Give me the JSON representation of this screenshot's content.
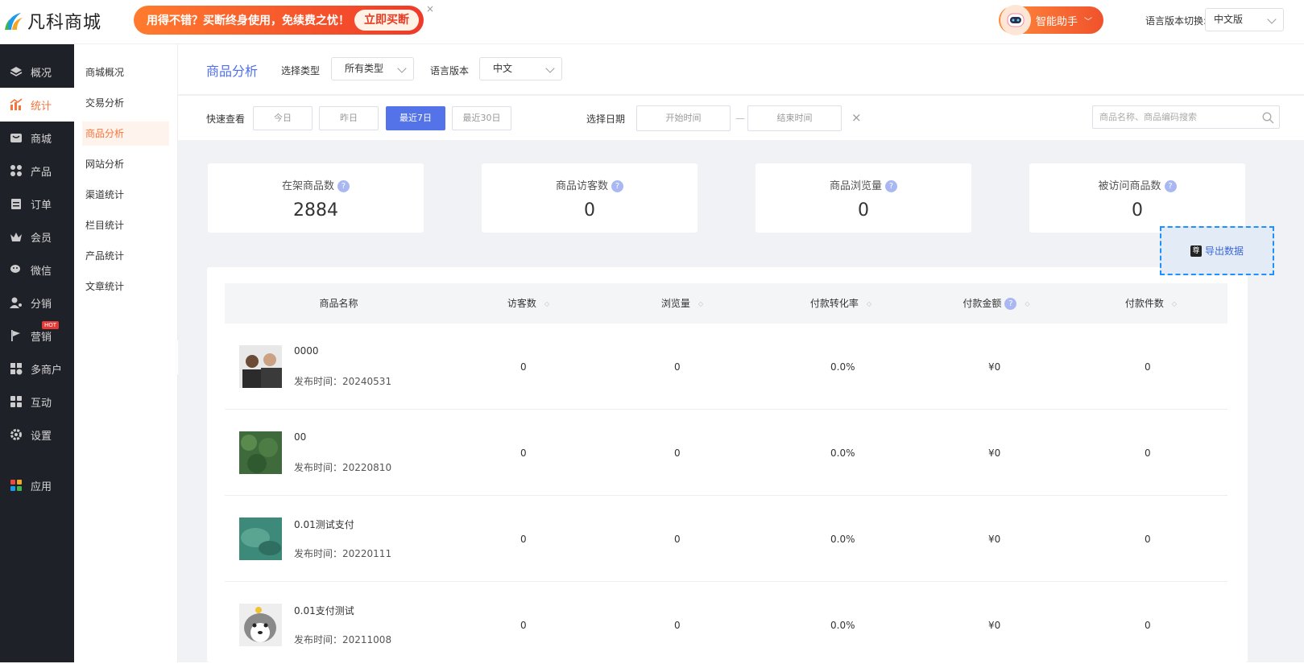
{
  "topbar": {
    "logo_text": "凡科商城",
    "banner_text": "用得不错？买断终身使用，免续费之忧！",
    "banner_button": "立即买断",
    "banner_close": "×",
    "assistant_label": "智能助手",
    "lang_switch_label": "语言版本切换:",
    "lang_value": "中文版"
  },
  "sidebar": {
    "items": [
      {
        "label": "概况",
        "icon": "layers-icon"
      },
      {
        "label": "统计",
        "icon": "chart-icon"
      },
      {
        "label": "商城",
        "icon": "shop-icon"
      },
      {
        "label": "产品",
        "icon": "product-icon"
      },
      {
        "label": "订单",
        "icon": "order-icon"
      },
      {
        "label": "会员",
        "icon": "crown-icon"
      },
      {
        "label": "微信",
        "icon": "wechat-icon"
      },
      {
        "label": "分销",
        "icon": "distribution-icon"
      },
      {
        "label": "营销",
        "icon": "flag-icon",
        "badge": "HOT"
      },
      {
        "label": "多商户",
        "icon": "merchant-icon"
      },
      {
        "label": "互动",
        "icon": "interact-icon"
      },
      {
        "label": "设置",
        "icon": "gear-icon"
      },
      {
        "label": "应用",
        "icon": "apps-icon"
      }
    ]
  },
  "subnav": {
    "items": [
      "商城概况",
      "交易分析",
      "商品分析",
      "网站分析",
      "渠道统计",
      "栏目统计",
      "产品统计",
      "文章统计"
    ]
  },
  "filters": {
    "title": "商品分析",
    "type_label": "选择类型",
    "type_value": "所有类型",
    "lang_label": "语言版本",
    "lang_value": "中文",
    "quick_label": "快速查看",
    "quick": [
      "今日",
      "昨日",
      "最近7日",
      "最近30日"
    ],
    "date_label": "选择日期",
    "start_placeholder": "开始时间",
    "date_sep": "—",
    "end_placeholder": "结束时间",
    "clear": "×",
    "search_placeholder": "商品名称、商品编码搜索"
  },
  "cards": [
    {
      "label": "在架商品数",
      "value": "2884"
    },
    {
      "label": "商品访客数",
      "value": "0"
    },
    {
      "label": "商品浏览量",
      "value": "0"
    },
    {
      "label": "被访问商品数",
      "value": "0"
    }
  ],
  "export_label": "导出数据",
  "export_icon_text": "尊",
  "table": {
    "headers": [
      "商品名称",
      "访客数",
      "浏览量",
      "付款转化率",
      "付款金额",
      "付款件数"
    ],
    "rows": [
      {
        "name": "0000",
        "date": "发布时间：20240531",
        "visitors": "0",
        "views": "0",
        "rate": "0.0%",
        "amount": "¥0",
        "count": "0",
        "thumb": "people"
      },
      {
        "name": "00",
        "date": "发布时间：20220810",
        "visitors": "0",
        "views": "0",
        "rate": "0.0%",
        "amount": "¥0",
        "count": "0",
        "thumb": "forest"
      },
      {
        "name": "0.01测试支付",
        "date": "发布时间：20220111",
        "visitors": "0",
        "views": "0",
        "rate": "0.0%",
        "amount": "¥0",
        "count": "0",
        "thumb": "water"
      },
      {
        "name": "0.01支付测试",
        "date": "发布时间：20211008",
        "visitors": "0",
        "views": "0",
        "rate": "0.0%",
        "amount": "¥0",
        "count": "0",
        "thumb": "dog"
      }
    ]
  },
  "colors": {
    "accent": "#f5743b",
    "primary": "#5473e8",
    "sidebar_bg": "#1f2129"
  }
}
